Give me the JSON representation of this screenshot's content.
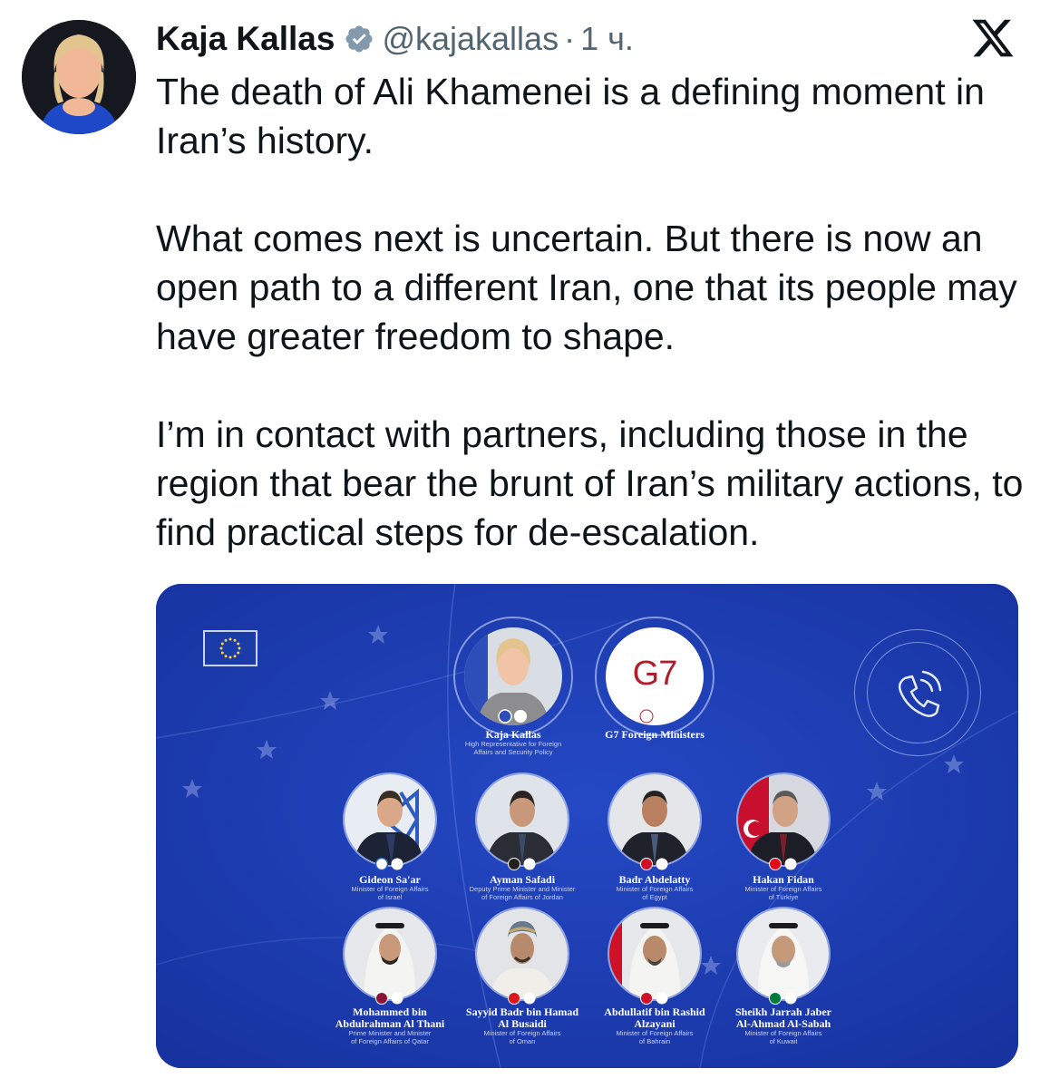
{
  "author": {
    "name": "Kaja Kallas",
    "handle": "@kajakallas",
    "separator": "·",
    "time": "1 ч."
  },
  "tweet": {
    "paragraphs": [
      "The death of Ali Khamenei is a defining moment in Iran’s history.",
      "What comes next is uncertain. But there is now an open path to a different Iran, one that its people may have greater freedom to shape.",
      "I’m in contact with partners, including those in the region that bear the brunt of Iran’s military actions, to find practical steps for de-escalation."
    ]
  },
  "graphic": {
    "g7_logo_text": "G7",
    "top": [
      {
        "name": "Kaja Kallas",
        "role": [
          "High Representative for Foreign",
          "Affairs and Security Policy"
        ]
      },
      {
        "name": "G7 Foreign Ministers",
        "role": []
      }
    ],
    "row1": [
      {
        "name": "Gideon Sa'ar",
        "role": [
          "Minister of Foreign Affairs",
          "of Israel"
        ]
      },
      {
        "name": "Ayman Safadi",
        "role": [
          "Deputy Prime Minister and Minister",
          "of Foreign Affairs of Jordan"
        ]
      },
      {
        "name": "Badr Abdelatty",
        "role": [
          "Minister of Foreign Affairs",
          "of Egypt"
        ]
      },
      {
        "name": "Hakan Fidan",
        "role": [
          "Minister of Foreign Affairs",
          "of Türkiye"
        ]
      }
    ],
    "row2": [
      {
        "name": [
          "Mohammed bin",
          "Abdulrahman Al Thani"
        ],
        "role": [
          "Prime Minister and Minister",
          "of Foreign Affairs of Qatar"
        ]
      },
      {
        "name": [
          "Sayyid Badr bin Hamad",
          "Al Busaidi"
        ],
        "role": [
          "Minister of Foreign Affairs",
          "of Oman"
        ]
      },
      {
        "name": [
          "Abdullatif bin Rashid",
          "Alzayani"
        ],
        "role": [
          "Minister of Foreign Affairs",
          "of Bahrain"
        ]
      },
      {
        "name": [
          "Sheikh Jarrah Jaber",
          "Al-Ahmad Al-Sabah"
        ],
        "role": [
          "Minister of Foreign Affairs",
          "of Kuwait"
        ]
      }
    ]
  },
  "colors": {
    "card_bg": "#1a3ba8",
    "text": "#0f1419",
    "muted": "#536471",
    "verified": "#829aab"
  }
}
